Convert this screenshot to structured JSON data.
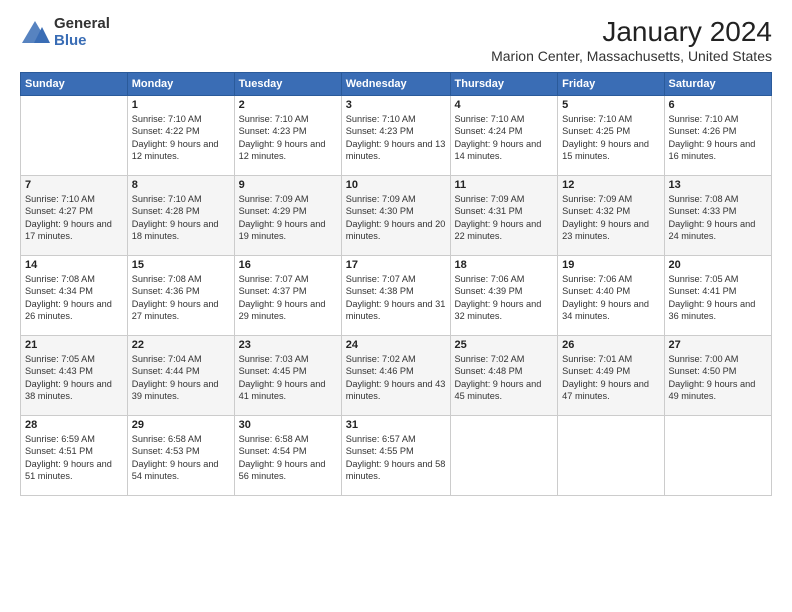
{
  "logo": {
    "general": "General",
    "blue": "Blue"
  },
  "title": "January 2024",
  "location": "Marion Center, Massachusetts, United States",
  "days_of_week": [
    "Sunday",
    "Monday",
    "Tuesday",
    "Wednesday",
    "Thursday",
    "Friday",
    "Saturday"
  ],
  "weeks": [
    [
      {
        "day": "",
        "sunrise": "",
        "sunset": "",
        "daylight": ""
      },
      {
        "day": "1",
        "sunrise": "Sunrise: 7:10 AM",
        "sunset": "Sunset: 4:22 PM",
        "daylight": "Daylight: 9 hours and 12 minutes."
      },
      {
        "day": "2",
        "sunrise": "Sunrise: 7:10 AM",
        "sunset": "Sunset: 4:23 PM",
        "daylight": "Daylight: 9 hours and 12 minutes."
      },
      {
        "day": "3",
        "sunrise": "Sunrise: 7:10 AM",
        "sunset": "Sunset: 4:23 PM",
        "daylight": "Daylight: 9 hours and 13 minutes."
      },
      {
        "day": "4",
        "sunrise": "Sunrise: 7:10 AM",
        "sunset": "Sunset: 4:24 PM",
        "daylight": "Daylight: 9 hours and 14 minutes."
      },
      {
        "day": "5",
        "sunrise": "Sunrise: 7:10 AM",
        "sunset": "Sunset: 4:25 PM",
        "daylight": "Daylight: 9 hours and 15 minutes."
      },
      {
        "day": "6",
        "sunrise": "Sunrise: 7:10 AM",
        "sunset": "Sunset: 4:26 PM",
        "daylight": "Daylight: 9 hours and 16 minutes."
      }
    ],
    [
      {
        "day": "7",
        "sunrise": "Sunrise: 7:10 AM",
        "sunset": "Sunset: 4:27 PM",
        "daylight": "Daylight: 9 hours and 17 minutes."
      },
      {
        "day": "8",
        "sunrise": "Sunrise: 7:10 AM",
        "sunset": "Sunset: 4:28 PM",
        "daylight": "Daylight: 9 hours and 18 minutes."
      },
      {
        "day": "9",
        "sunrise": "Sunrise: 7:09 AM",
        "sunset": "Sunset: 4:29 PM",
        "daylight": "Daylight: 9 hours and 19 minutes."
      },
      {
        "day": "10",
        "sunrise": "Sunrise: 7:09 AM",
        "sunset": "Sunset: 4:30 PM",
        "daylight": "Daylight: 9 hours and 20 minutes."
      },
      {
        "day": "11",
        "sunrise": "Sunrise: 7:09 AM",
        "sunset": "Sunset: 4:31 PM",
        "daylight": "Daylight: 9 hours and 22 minutes."
      },
      {
        "day": "12",
        "sunrise": "Sunrise: 7:09 AM",
        "sunset": "Sunset: 4:32 PM",
        "daylight": "Daylight: 9 hours and 23 minutes."
      },
      {
        "day": "13",
        "sunrise": "Sunrise: 7:08 AM",
        "sunset": "Sunset: 4:33 PM",
        "daylight": "Daylight: 9 hours and 24 minutes."
      }
    ],
    [
      {
        "day": "14",
        "sunrise": "Sunrise: 7:08 AM",
        "sunset": "Sunset: 4:34 PM",
        "daylight": "Daylight: 9 hours and 26 minutes."
      },
      {
        "day": "15",
        "sunrise": "Sunrise: 7:08 AM",
        "sunset": "Sunset: 4:36 PM",
        "daylight": "Daylight: 9 hours and 27 minutes."
      },
      {
        "day": "16",
        "sunrise": "Sunrise: 7:07 AM",
        "sunset": "Sunset: 4:37 PM",
        "daylight": "Daylight: 9 hours and 29 minutes."
      },
      {
        "day": "17",
        "sunrise": "Sunrise: 7:07 AM",
        "sunset": "Sunset: 4:38 PM",
        "daylight": "Daylight: 9 hours and 31 minutes."
      },
      {
        "day": "18",
        "sunrise": "Sunrise: 7:06 AM",
        "sunset": "Sunset: 4:39 PM",
        "daylight": "Daylight: 9 hours and 32 minutes."
      },
      {
        "day": "19",
        "sunrise": "Sunrise: 7:06 AM",
        "sunset": "Sunset: 4:40 PM",
        "daylight": "Daylight: 9 hours and 34 minutes."
      },
      {
        "day": "20",
        "sunrise": "Sunrise: 7:05 AM",
        "sunset": "Sunset: 4:41 PM",
        "daylight": "Daylight: 9 hours and 36 minutes."
      }
    ],
    [
      {
        "day": "21",
        "sunrise": "Sunrise: 7:05 AM",
        "sunset": "Sunset: 4:43 PM",
        "daylight": "Daylight: 9 hours and 38 minutes."
      },
      {
        "day": "22",
        "sunrise": "Sunrise: 7:04 AM",
        "sunset": "Sunset: 4:44 PM",
        "daylight": "Daylight: 9 hours and 39 minutes."
      },
      {
        "day": "23",
        "sunrise": "Sunrise: 7:03 AM",
        "sunset": "Sunset: 4:45 PM",
        "daylight": "Daylight: 9 hours and 41 minutes."
      },
      {
        "day": "24",
        "sunrise": "Sunrise: 7:02 AM",
        "sunset": "Sunset: 4:46 PM",
        "daylight": "Daylight: 9 hours and 43 minutes."
      },
      {
        "day": "25",
        "sunrise": "Sunrise: 7:02 AM",
        "sunset": "Sunset: 4:48 PM",
        "daylight": "Daylight: 9 hours and 45 minutes."
      },
      {
        "day": "26",
        "sunrise": "Sunrise: 7:01 AM",
        "sunset": "Sunset: 4:49 PM",
        "daylight": "Daylight: 9 hours and 47 minutes."
      },
      {
        "day": "27",
        "sunrise": "Sunrise: 7:00 AM",
        "sunset": "Sunset: 4:50 PM",
        "daylight": "Daylight: 9 hours and 49 minutes."
      }
    ],
    [
      {
        "day": "28",
        "sunrise": "Sunrise: 6:59 AM",
        "sunset": "Sunset: 4:51 PM",
        "daylight": "Daylight: 9 hours and 51 minutes."
      },
      {
        "day": "29",
        "sunrise": "Sunrise: 6:58 AM",
        "sunset": "Sunset: 4:53 PM",
        "daylight": "Daylight: 9 hours and 54 minutes."
      },
      {
        "day": "30",
        "sunrise": "Sunrise: 6:58 AM",
        "sunset": "Sunset: 4:54 PM",
        "daylight": "Daylight: 9 hours and 56 minutes."
      },
      {
        "day": "31",
        "sunrise": "Sunrise: 6:57 AM",
        "sunset": "Sunset: 4:55 PM",
        "daylight": "Daylight: 9 hours and 58 minutes."
      },
      {
        "day": "",
        "sunrise": "",
        "sunset": "",
        "daylight": ""
      },
      {
        "day": "",
        "sunrise": "",
        "sunset": "",
        "daylight": ""
      },
      {
        "day": "",
        "sunrise": "",
        "sunset": "",
        "daylight": ""
      }
    ]
  ]
}
